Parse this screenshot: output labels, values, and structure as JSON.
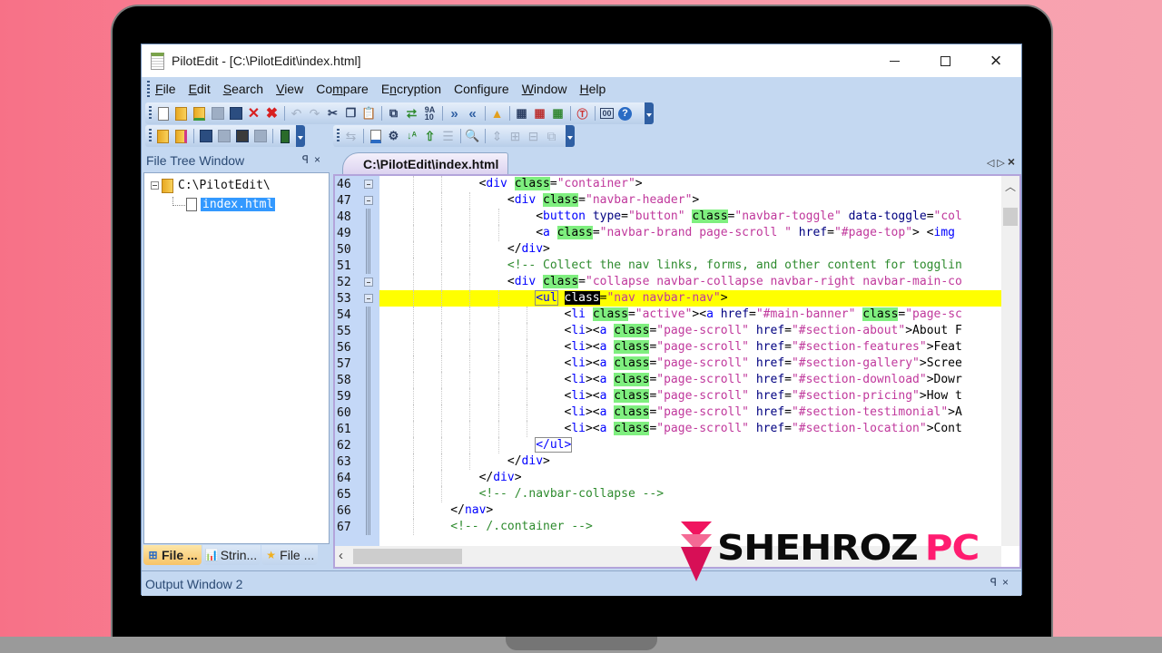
{
  "window": {
    "title": "PilotEdit - [C:\\PilotEdit\\index.html]",
    "controls": {
      "minimize": "minimize",
      "maximize": "maximize",
      "close": "×"
    }
  },
  "menu": [
    {
      "label": "File",
      "u": "F",
      "rest": "ile"
    },
    {
      "label": "Edit",
      "u": "E",
      "rest": "dit"
    },
    {
      "label": "Search",
      "u": "S",
      "rest": "earch"
    },
    {
      "label": "View",
      "u": "V",
      "rest": "iew"
    },
    {
      "label": "Compare",
      "pre": "Co",
      "u": "m",
      "rest": "pare"
    },
    {
      "label": "Encryption",
      "pre": "E",
      "u": "n",
      "rest": "cryption"
    },
    {
      "label": "Configure",
      "pre": "Confi",
      "u": "g",
      "rest": "ure"
    },
    {
      "label": "Window",
      "u": "W",
      "rest": "indow"
    },
    {
      "label": "Help",
      "u": "H",
      "rest": "elp"
    }
  ],
  "toolbar": {
    "main": [
      "new-file",
      "open-file",
      "open-remote",
      "save",
      "save-as",
      "close",
      "close-all",
      "undo",
      "redo",
      "cut",
      "copy",
      "paste",
      "select",
      "replace",
      "hex",
      "indent",
      "unindent",
      "bookmark",
      "find-in-files",
      "find-prev",
      "find-next",
      "compare",
      "hex-mode",
      "help"
    ],
    "secondary": [
      "open-encrypted",
      "open-remote-encrypted",
      "save-encrypted",
      "save-encrypted-disabled",
      "save-as-encrypted",
      "save-as-encrypted-disabled",
      "lock"
    ],
    "tertiary": [
      "macro",
      "settings",
      "gear",
      "sort-az",
      "move-up",
      "indent-list",
      "find-doc",
      "expand",
      "add",
      "remove",
      "collapse"
    ]
  },
  "file_tree": {
    "title": "File Tree Window",
    "root": "C:\\PilotEdit\\",
    "children": [
      "index.html"
    ],
    "selected": "index.html",
    "pin": "ᵖ",
    "close": "×",
    "tabs": [
      {
        "label": "File ...",
        "active": true
      },
      {
        "label": "Strin...",
        "active": false
      },
      {
        "label": "File ...",
        "active": false
      }
    ]
  },
  "editor": {
    "tab_label": "C:\\PilotEdit\\index.html",
    "tab_nav": "◁ ▷ ×",
    "current_line": 53,
    "lines": [
      {
        "n": 46,
        "fold": "box"
      },
      {
        "n": 47,
        "fold": "box"
      },
      {
        "n": 48,
        "fold": "bar"
      },
      {
        "n": 49,
        "fold": "bar"
      },
      {
        "n": 50,
        "fold": "bar"
      },
      {
        "n": 51,
        "fold": "bar"
      },
      {
        "n": 52,
        "fold": "box"
      },
      {
        "n": 53,
        "fold": "box"
      },
      {
        "n": 54,
        "fold": "bar"
      },
      {
        "n": 55,
        "fold": "bar"
      },
      {
        "n": 56,
        "fold": "bar"
      },
      {
        "n": 57,
        "fold": "bar"
      },
      {
        "n": 58,
        "fold": "bar"
      },
      {
        "n": 59,
        "fold": "bar"
      },
      {
        "n": 60,
        "fold": "bar"
      },
      {
        "n": 61,
        "fold": "bar"
      },
      {
        "n": 62,
        "fold": "bar"
      },
      {
        "n": 63,
        "fold": "bar"
      },
      {
        "n": 64,
        "fold": "bar"
      },
      {
        "n": 65,
        "fold": "bar"
      },
      {
        "n": 66,
        "fold": "bar"
      },
      {
        "n": 67,
        "fold": "bar"
      }
    ],
    "code": [
      [
        [
          12,
          ""
        ],
        [
          "br",
          "<"
        ],
        [
          "tag",
          "div"
        ],
        [
          "sp",
          " "
        ],
        [
          "cls",
          "class"
        ],
        [
          "br",
          "="
        ],
        [
          "str",
          "\"container\""
        ],
        [
          "br",
          ">"
        ]
      ],
      [
        [
          16,
          ""
        ],
        [
          "br",
          "<"
        ],
        [
          "tag",
          "div"
        ],
        [
          "sp",
          " "
        ],
        [
          "cls",
          "class"
        ],
        [
          "br",
          "="
        ],
        [
          "str",
          "\"navbar-header\""
        ],
        [
          "br",
          ">"
        ]
      ],
      [
        [
          20,
          ""
        ],
        [
          "br",
          "<"
        ],
        [
          "tag",
          "button"
        ],
        [
          "sp",
          " "
        ],
        [
          "attr",
          "type"
        ],
        [
          "br",
          "="
        ],
        [
          "str",
          "\"button\""
        ],
        [
          "sp",
          " "
        ],
        [
          "cls",
          "class"
        ],
        [
          "br",
          "="
        ],
        [
          "str",
          "\"navbar-toggle\""
        ],
        [
          "sp",
          " "
        ],
        [
          "attr",
          "data-toggle"
        ],
        [
          "br",
          "="
        ],
        [
          "str",
          "\"col"
        ]
      ],
      [
        [
          20,
          ""
        ],
        [
          "br",
          "<"
        ],
        [
          "tag",
          "a"
        ],
        [
          "sp",
          " "
        ],
        [
          "cls",
          "class"
        ],
        [
          "br",
          "="
        ],
        [
          "str",
          "\"navbar-brand page-scroll \""
        ],
        [
          "sp",
          " "
        ],
        [
          "attr",
          "href"
        ],
        [
          "br",
          "="
        ],
        [
          "str",
          "\"#page-top\""
        ],
        [
          "br",
          "> <"
        ],
        [
          "tag",
          "img"
        ]
      ],
      [
        [
          16,
          ""
        ],
        [
          "br",
          "</"
        ],
        [
          "tag",
          "div"
        ],
        [
          "br",
          ">"
        ]
      ],
      [
        [
          16,
          ""
        ],
        [
          "com",
          "<!-- Collect the nav links, forms, and other content for togglin"
        ]
      ],
      [
        [
          16,
          ""
        ],
        [
          "br",
          "<"
        ],
        [
          "tag",
          "div"
        ],
        [
          "sp",
          " "
        ],
        [
          "cls",
          "class"
        ],
        [
          "br",
          "="
        ],
        [
          "str",
          "\"collapse navbar-collapse navbar-right navbar-main-co"
        ]
      ],
      [
        [
          20,
          ""
        ],
        [
          "ulbox",
          "<ul"
        ],
        [
          "sp",
          " "
        ],
        [
          "sel",
          "class"
        ],
        [
          "br",
          "="
        ],
        [
          "str",
          "\"nav navbar-nav\""
        ],
        [
          "br",
          ">"
        ]
      ],
      [
        [
          24,
          ""
        ],
        [
          "br",
          "<"
        ],
        [
          "tag",
          "li"
        ],
        [
          "sp",
          " "
        ],
        [
          "cls",
          "class"
        ],
        [
          "br",
          "="
        ],
        [
          "str",
          "\"active\""
        ],
        [
          "br",
          "><"
        ],
        [
          "tag",
          "a"
        ],
        [
          "sp",
          " "
        ],
        [
          "attr",
          "href"
        ],
        [
          "br",
          "="
        ],
        [
          "str",
          "\"#main-banner\""
        ],
        [
          "sp",
          " "
        ],
        [
          "cls",
          "class"
        ],
        [
          "br",
          "="
        ],
        [
          "str",
          "\"page-sc"
        ]
      ],
      [
        [
          24,
          ""
        ],
        [
          "br",
          "<"
        ],
        [
          "tag",
          "li"
        ],
        [
          "br",
          "><"
        ],
        [
          "tag",
          "a"
        ],
        [
          "sp",
          " "
        ],
        [
          "cls",
          "class"
        ],
        [
          "br",
          "="
        ],
        [
          "str",
          "\"page-scroll\""
        ],
        [
          "sp",
          " "
        ],
        [
          "attr",
          "href"
        ],
        [
          "br",
          "="
        ],
        [
          "str",
          "\"#section-about\""
        ],
        [
          "br",
          ">About F"
        ]
      ],
      [
        [
          24,
          ""
        ],
        [
          "br",
          "<"
        ],
        [
          "tag",
          "li"
        ],
        [
          "br",
          "><"
        ],
        [
          "tag",
          "a"
        ],
        [
          "sp",
          " "
        ],
        [
          "cls",
          "class"
        ],
        [
          "br",
          "="
        ],
        [
          "str",
          "\"page-scroll\""
        ],
        [
          "sp",
          " "
        ],
        [
          "attr",
          "href"
        ],
        [
          "br",
          "="
        ],
        [
          "str",
          "\"#section-features\""
        ],
        [
          "br",
          ">Feat"
        ]
      ],
      [
        [
          24,
          ""
        ],
        [
          "br",
          "<"
        ],
        [
          "tag",
          "li"
        ],
        [
          "br",
          "><"
        ],
        [
          "tag",
          "a"
        ],
        [
          "sp",
          " "
        ],
        [
          "cls",
          "class"
        ],
        [
          "br",
          "="
        ],
        [
          "str",
          "\"page-scroll\""
        ],
        [
          "sp",
          " "
        ],
        [
          "attr",
          "href"
        ],
        [
          "br",
          "="
        ],
        [
          "str",
          "\"#section-gallery\""
        ],
        [
          "br",
          ">Scree"
        ]
      ],
      [
        [
          24,
          ""
        ],
        [
          "br",
          "<"
        ],
        [
          "tag",
          "li"
        ],
        [
          "br",
          "><"
        ],
        [
          "tag",
          "a"
        ],
        [
          "sp",
          " "
        ],
        [
          "cls",
          "class"
        ],
        [
          "br",
          "="
        ],
        [
          "str",
          "\"page-scroll\""
        ],
        [
          "sp",
          " "
        ],
        [
          "attr",
          "href"
        ],
        [
          "br",
          "="
        ],
        [
          "str",
          "\"#section-download\""
        ],
        [
          "br",
          ">Dowr"
        ]
      ],
      [
        [
          24,
          ""
        ],
        [
          "br",
          "<"
        ],
        [
          "tag",
          "li"
        ],
        [
          "br",
          "><"
        ],
        [
          "tag",
          "a"
        ],
        [
          "sp",
          " "
        ],
        [
          "cls",
          "class"
        ],
        [
          "br",
          "="
        ],
        [
          "str",
          "\"page-scroll\""
        ],
        [
          "sp",
          " "
        ],
        [
          "attr",
          "href"
        ],
        [
          "br",
          "="
        ],
        [
          "str",
          "\"#section-pricing\""
        ],
        [
          "br",
          ">How t"
        ]
      ],
      [
        [
          24,
          ""
        ],
        [
          "br",
          "<"
        ],
        [
          "tag",
          "li"
        ],
        [
          "br",
          "><"
        ],
        [
          "tag",
          "a"
        ],
        [
          "sp",
          " "
        ],
        [
          "cls",
          "class"
        ],
        [
          "br",
          "="
        ],
        [
          "str",
          "\"page-scroll\""
        ],
        [
          "sp",
          " "
        ],
        [
          "attr",
          "href"
        ],
        [
          "br",
          "="
        ],
        [
          "str",
          "\"#section-testimonial\""
        ],
        [
          "br",
          ">A"
        ]
      ],
      [
        [
          24,
          ""
        ],
        [
          "br",
          "<"
        ],
        [
          "tag",
          "li"
        ],
        [
          "br",
          "><"
        ],
        [
          "tag",
          "a"
        ],
        [
          "sp",
          " "
        ],
        [
          "cls",
          "class"
        ],
        [
          "br",
          "="
        ],
        [
          "str",
          "\"page-scroll\""
        ],
        [
          "sp",
          " "
        ],
        [
          "attr",
          "href"
        ],
        [
          "br",
          "="
        ],
        [
          "str",
          "\"#section-location\""
        ],
        [
          "br",
          ">Cont"
        ]
      ],
      [
        [
          20,
          ""
        ],
        [
          "ulbox",
          "</ul>"
        ]
      ],
      [
        [
          16,
          ""
        ],
        [
          "br",
          "</"
        ],
        [
          "tag",
          "div"
        ],
        [
          "br",
          ">"
        ]
      ],
      [
        [
          12,
          ""
        ],
        [
          "br",
          "</"
        ],
        [
          "tag",
          "div"
        ],
        [
          "br",
          ">"
        ]
      ],
      [
        [
          12,
          ""
        ],
        [
          "com",
          "<!-- /.navbar-collapse -->"
        ]
      ],
      [
        [
          8,
          ""
        ],
        [
          "br",
          "</"
        ],
        [
          "tag",
          "nav"
        ],
        [
          "br",
          ">"
        ]
      ],
      [
        [
          8,
          ""
        ],
        [
          "com",
          "<!-- /.container -->"
        ]
      ]
    ]
  },
  "output": {
    "title": "Output Window 2",
    "pin": "ᵖ",
    "close": "×"
  },
  "watermark": {
    "black": "SHEHROZ",
    "pink": "PC"
  }
}
